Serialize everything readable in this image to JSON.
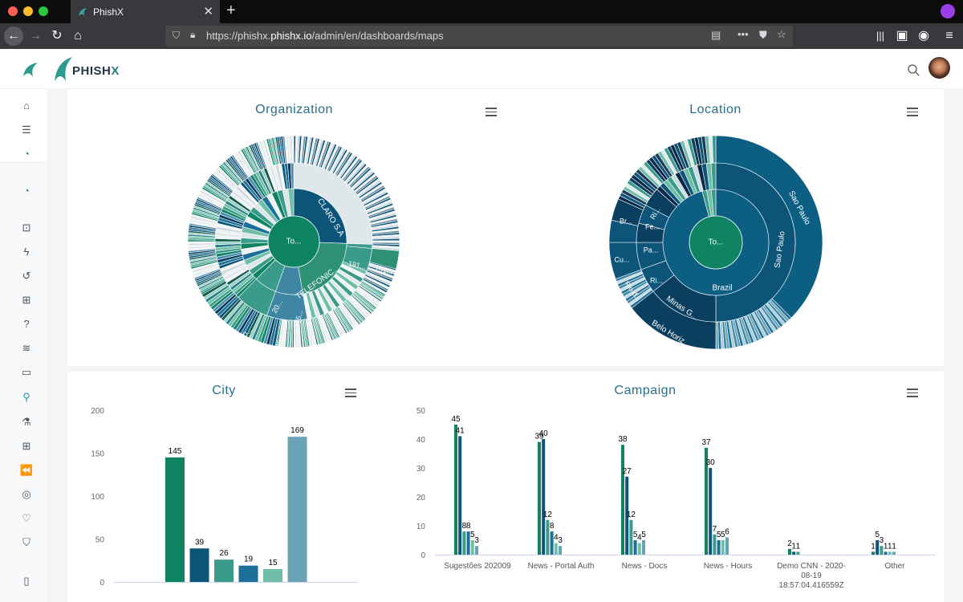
{
  "browser": {
    "tab_title": "PhishX",
    "url_prefix": "https://phishx.",
    "url_domain": "phishx.io",
    "url_path": "/admin/en/dashboards/maps"
  },
  "app": {
    "brand_prefix": "PHISH",
    "brand_suffix": "X"
  },
  "colors": {
    "accent": "#2a6f8a",
    "green": "#0e8463",
    "navy": "#0c5478",
    "teal": "#3a9b8a",
    "blue": "#1b6f98",
    "mint": "#6fbfa8",
    "steel": "#69a3b5"
  },
  "sidebar": {
    "icons": [
      "home-icon",
      "servers-icon",
      "chart-pie-icon",
      "chart-pie-outline-icon",
      "scan-icon",
      "bolt-icon",
      "history-icon",
      "image-chart-icon",
      "question-icon",
      "database-icon",
      "monitor-icon",
      "location-icon",
      "flask-icon",
      "network-icon",
      "rewind-icon",
      "badge-icon",
      "heart-pulse-icon",
      "shield-icon",
      "file-icon"
    ]
  },
  "panels": {
    "organization": {
      "title": "Organization",
      "labels": [
        "To...",
        "CLARO S.A",
        "TELEFONIC...",
        "191...",
        "191...",
        "20...",
        "45...",
        "20...",
        "45..."
      ]
    },
    "location": {
      "title": "Location",
      "labels": [
        "To...",
        "Brazil",
        "Sao Paulo",
        "Sao Paulo",
        "Minas G...",
        "Belo Horiz...",
        "Rio d...",
        "Cu...",
        "Pa...",
        "Ri...",
        "Fe...",
        "Ri...",
        "Br...",
        "Ri..."
      ]
    },
    "city": {
      "title": "City"
    },
    "campaign": {
      "title": "Campaign"
    }
  },
  "chart_data": [
    {
      "type": "bar",
      "title": "City",
      "values": [
        145,
        39,
        26,
        19,
        15,
        169
      ],
      "ylim": [
        0,
        200
      ],
      "yticks": [
        0,
        50,
        100,
        150,
        200
      ],
      "grid": false,
      "colors": [
        "#0e8463",
        "#0c5478",
        "#3a9b8a",
        "#1b6f98",
        "#6fbfa8",
        "#69a3b5"
      ]
    },
    {
      "type": "bar",
      "title": "Campaign",
      "categories": [
        "Sugestões 202009",
        "News - Portal Auth",
        "News - Docs",
        "News - Hours",
        "Demo CNN - 2020-08-19 18:57:04.416559Z",
        "Other"
      ],
      "ylim": [
        0,
        50
      ],
      "yticks": [
        0,
        10,
        20,
        30,
        40,
        50
      ],
      "grid": false,
      "colors": [
        "#0e8463",
        "#0c5478",
        "#3a9b8a",
        "#1b6f98",
        "#6fbfa8",
        "#69a3b5"
      ],
      "series_values": [
        [
          45,
          41,
          8,
          8,
          5,
          3
        ],
        [
          39,
          40,
          12,
          8,
          4,
          3
        ],
        [
          38,
          27,
          12,
          5,
          4,
          5
        ],
        [
          37,
          30,
          7,
          5,
          5,
          6
        ],
        [
          2,
          1,
          1
        ],
        [
          1,
          5,
          3,
          1,
          1,
          1
        ]
      ]
    }
  ]
}
